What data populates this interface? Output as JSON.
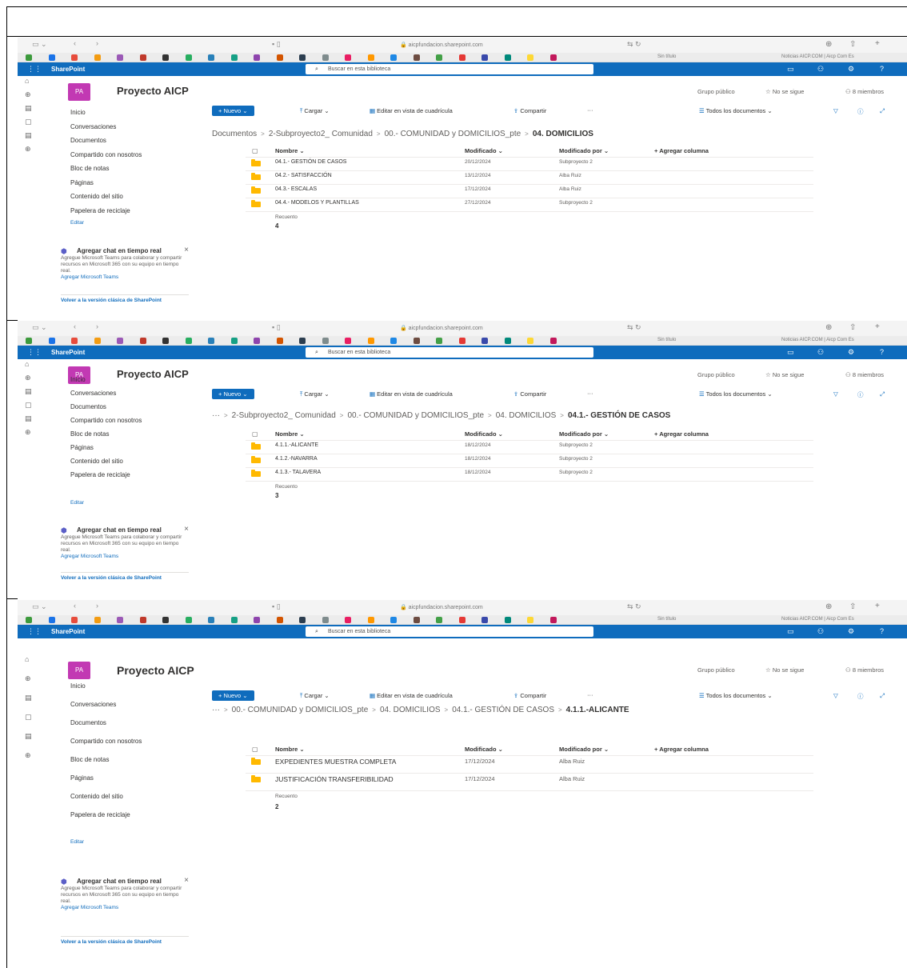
{
  "browser": {
    "url": "aicpfundacion.sharepoint.com",
    "tab_title": "Sin título",
    "tab_title_2": "Noticias AICP.COM | Aicp Com Es"
  },
  "suite": {
    "brand": "SharePoint",
    "search_placeholder": "Buscar en esta biblioteca"
  },
  "site": {
    "badge": "PA",
    "title": "Proyecto AICP",
    "visibility": "Grupo público",
    "follow": "No se sigue",
    "members": "8 miembros"
  },
  "nav": {
    "items": [
      "Inicio",
      "Conversaciones",
      "Documentos",
      "Compartido con nosotros",
      "Bloc de notas",
      "Páginas",
      "Contenido del sitio",
      "Papelera de reciclaje"
    ],
    "edit": "Editar",
    "chat_title": "Agregar chat en tiempo real",
    "chat_body": "Agregue Microsoft Teams para colaborar y compartir recursos en Microsoft 365 con su equipo en tiempo real.",
    "chat_link": "Agregar Microsoft Teams",
    "classic": "Volver a la versión clásica de SharePoint"
  },
  "command_bar": {
    "new": "Nuevo",
    "upload": "Cargar",
    "grid_edit": "Editar en vista de cuadrícula",
    "share": "Compartir",
    "more": "···",
    "view": "Todos los documentos"
  },
  "columns": {
    "name": "Nombre",
    "modified": "Modificado",
    "modified_by": "Modificado por",
    "add": "Agregar columna"
  },
  "count_label": "Recuento",
  "screens": [
    {
      "breadcrumb": [
        "Documentos",
        "2-Subproyecto2_ Comunidad",
        "00.- COMUNIDAD y DOMICILIOS_pte"
      ],
      "current": "04. DOMICILIOS",
      "rows": [
        {
          "name": "04.1.- GESTIÓN DE CASOS",
          "modified": "20/12/2024",
          "by": "Subproyecto 2"
        },
        {
          "name": "04.2.- SATISFACCIÓN",
          "modified": "13/12/2024",
          "by": "Alba Ruiz"
        },
        {
          "name": "04.3.- ESCALAS",
          "modified": "17/12/2024",
          "by": "Alba Ruiz"
        },
        {
          "name": "04.4.- MODELOS Y PLANTILLAS",
          "modified": "27/12/2024",
          "by": "Subproyecto 2"
        }
      ],
      "count": "4"
    },
    {
      "breadcrumb": [
        "···",
        "2-Subproyecto2_ Comunidad",
        "00.- COMUNIDAD y DOMICILIOS_pte",
        "04. DOMICILIOS"
      ],
      "current": "04.1.- GESTIÓN DE CASOS",
      "rows": [
        {
          "name": "4.1.1.-ALICANTE",
          "modified": "18/12/2024",
          "by": "Subproyecto 2"
        },
        {
          "name": "4.1.2.-NAVARRA",
          "modified": "18/12/2024",
          "by": "Subproyecto 2"
        },
        {
          "name": "4.1.3.- TALAVERA",
          "modified": "18/12/2024",
          "by": "Subproyecto 2"
        }
      ],
      "count": "3"
    },
    {
      "breadcrumb": [
        "···",
        "00.- COMUNIDAD y DOMICILIOS_pte",
        "04. DOMICILIOS",
        "04.1.- GESTIÓN DE CASOS"
      ],
      "current": "4.1.1.-ALICANTE",
      "rows": [
        {
          "name": "EXPEDIENTES MUESTRA COMPLETA",
          "modified": "17/12/2024",
          "by": "Alba Ruiz"
        },
        {
          "name": "JUSTIFICACIÓN TRANSFERIBILIDAD",
          "modified": "17/12/2024",
          "by": "Alba Ruiz"
        }
      ],
      "count": "2"
    }
  ]
}
